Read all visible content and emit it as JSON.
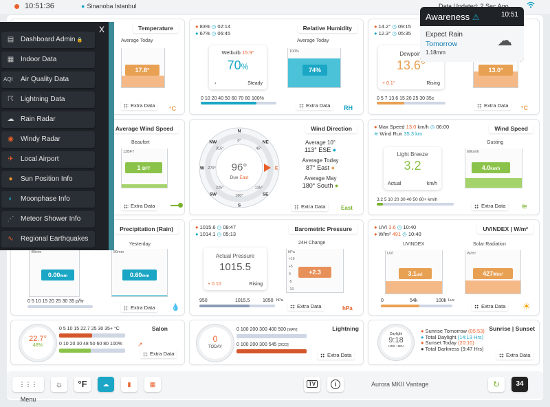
{
  "topbar": {
    "time": "10:51:36",
    "location": "Sinanoba Istanbul",
    "updated": "Data Updated: 2 Sec Ago"
  },
  "sidebar": {
    "close": "X",
    "items": [
      {
        "label": "Dashboard Admin",
        "icon": "dashboard-icon"
      },
      {
        "label": "Indoor Data",
        "icon": "indoor-icon"
      },
      {
        "label": "Air Quality Data",
        "icon": "aqi-icon",
        "icon_text": "AQI"
      },
      {
        "label": "Lightning Data",
        "icon": "lightning-icon"
      },
      {
        "label": "Rain Radar",
        "icon": "rain-radar-icon"
      },
      {
        "label": "Windy Radar",
        "icon": "windy-icon"
      },
      {
        "label": "Local Airport",
        "icon": "airplane-icon"
      },
      {
        "label": "Sun Position Info",
        "icon": "sun-icon"
      },
      {
        "label": "Moonphase Info",
        "icon": "moon-icon"
      },
      {
        "label": "Meteor Shower Info",
        "icon": "meteor-icon"
      },
      {
        "label": "Regional Earthquakes",
        "icon": "earthquake-icon"
      }
    ]
  },
  "awareness": {
    "title": "Awareness",
    "time": "10:51",
    "line1": "Expect Rain",
    "line2": "Tomorrow",
    "amount": "1.18mm"
  },
  "extra_label": "Extra Data",
  "temperature": {
    "title": "Temperature",
    "sub": "Average Today",
    "value": "17.8°",
    "unit": "°C",
    "level": 0.3
  },
  "humidity": {
    "title": "Relative Humidity",
    "h1": "83%",
    "h1t": "02:14",
    "h2": "67%",
    "h2t": "06:45",
    "wetbulb": "Wetbulb",
    "wetbulb_val": "15.9°",
    "value": "70",
    "pct": "%",
    "trend": "Steady",
    "sub": "Average Today",
    "box_top": "100%",
    "pill": "74%",
    "scale": "0 10 20 40 50 60 70 80 100%",
    "unit": "RH",
    "level": 0.74
  },
  "dewpoint": {
    "h1": "14.2°",
    "h1t": "09:15",
    "h2": "12.3°",
    "h2t": "05:35",
    "label": "Dewpoint",
    "value": "13.6°",
    "delta": "+ 0.1°",
    "trend": "Rising",
    "pill": "13.0°",
    "scale": "0 5 7 13.6 15 20 25 30 35c",
    "unit": "°C",
    "level": 0.4
  },
  "wind_speed": {
    "title": "Average Wind Speed",
    "label": "Beaufort",
    "pill": "1",
    "pill_unit": "BFT",
    "scale_top": "12BFT",
    "level": 0.08
  },
  "wind_direction": {
    "title": "Wind Direction",
    "compass": [
      "N",
      "NE",
      "E",
      "SE",
      "S",
      "SW",
      "W",
      "NW"
    ],
    "deg_labels": [
      "0°",
      "45°",
      "90°",
      "135°",
      "180°",
      "225°",
      "270°",
      "315°"
    ],
    "value": "96°",
    "due": "Due",
    "due_dir": "East",
    "avg10_label": "Average 10°",
    "avg10": "113°",
    "avg10_dir": "ESE",
    "avgtoday_label": "Average Today",
    "avgtoday": "87°",
    "avgtoday_dir": "East",
    "avgmay_label": "Average May",
    "avgmay": "180°",
    "avgmay_dir": "South",
    "dir": "East"
  },
  "gust": {
    "title": "Wind Speed",
    "max": "Max Speed",
    "max_val": "13.0",
    "max_unit": "km/h",
    "max_time": "06:00",
    "run": "Wind Run",
    "run_val": "35.3 km",
    "card_label": "Light Breeze",
    "value": "3.2",
    "actual": "Actual",
    "unit": "km/h",
    "scale": "3.2 5 10 20 30 40 50 60+ km/h",
    "gusting": "Gusting",
    "box_top": "60km/h",
    "pill": "4.0",
    "pill_unit": "km/h",
    "level": 0.25
  },
  "precip": {
    "title": "Precipitation (Rain)",
    "yesterday": "Yesterday",
    "pill1": "0.00",
    "pill1_unit": "mm",
    "pill2": "0.60",
    "pill2_unit": "mm",
    "box1_top": "40mm",
    "box2_top": "80mm",
    "scale": "0 5 10 15 20 25 30 35 p/hr"
  },
  "pressure": {
    "title": "Barometric Pressure",
    "h1": "1015.6",
    "h1t": "08:47",
    "h2": "1014.1",
    "h2t": "05:13",
    "label": "Actual Pressure",
    "value": "1015.5",
    "delta": "+ 0.10",
    "trend": "Rising",
    "change": "24H Change",
    "box_top": "hPa",
    "ticks": [
      "+10",
      "+5",
      "0",
      "-5",
      "-10"
    ],
    "pill": "+2.3",
    "s1": "950",
    "s2": "1015.5",
    "s3": "1050",
    "s_unit": "hPa",
    "unit": "hPa"
  },
  "uv": {
    "title": "UVINDEX | W/m²",
    "h1": "UVI",
    "h1v": "3.6",
    "h1t": "10:40",
    "h2": "W/m²",
    "h2v": "491",
    "h2t": "10:40",
    "uvlabel": "UVINDEX",
    "solar": "Solar Radiation",
    "uvtop": "UVI",
    "solartop": "W/m²",
    "pill1": "3.1",
    "pill1_unit": "uvi",
    "pill2": "427",
    "pill2_unit": "W/m²",
    "s1": "0",
    "s2": "54k",
    "s3": "100k",
    "s_unit": "Lux"
  },
  "salon": {
    "title": "Salon",
    "temp": "22.7°",
    "hum": "48",
    "hum_unit": "%",
    "scale1": "0 5 10 15 22.7 25 30 35+ °C",
    "scale2": "0 10 20 30 48 50 60 80 100%"
  },
  "lightning": {
    "title": "Lightning",
    "count": "0",
    "today": "TODAY",
    "scale1": "0 100 200 300 400 500",
    "s1tag": "[MAY]",
    "scale2": "0 100 200 300 545",
    "s2tag": "[2023]"
  },
  "sun": {
    "title": "Sunrise | Sunset",
    "daylight": "Daylight",
    "dl_value": "9:18",
    "hrs": "HRS : MIN",
    "rows": [
      {
        "label": "Sunrise Tomorrow",
        "val": "(05:53)",
        "color": "#e8612c"
      },
      {
        "label": "Total Daylight",
        "val": "(14:13 Hrs)",
        "color": "#1aa6c4"
      },
      {
        "label": "Sunset Today",
        "val": "(20:10)",
        "color": "#e8612c"
      },
      {
        "label": "Total Darkness",
        "val": "(9:47 Hrs)",
        "color": "#333333"
      }
    ]
  },
  "bottombar": {
    "menu": "Menu",
    "unit_f": "°F",
    "tv": "TV",
    "info": "i",
    "station": "Aurora MKII Vantage",
    "cal_num": "34"
  },
  "colors": {
    "orange": "#e8612c",
    "teal": "#1aa6c4",
    "green": "#7ab22e"
  }
}
